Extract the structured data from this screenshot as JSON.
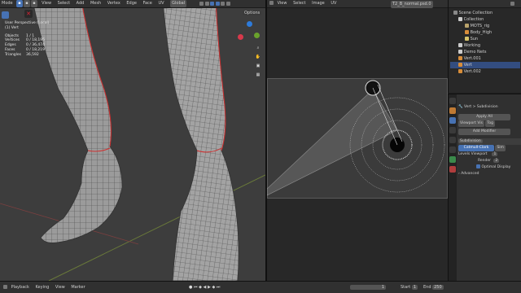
{
  "viewport3d": {
    "mode_label": "Mode",
    "menu": [
      "View",
      "Select",
      "Add",
      "Mesh",
      "Vertex",
      "Edge",
      "Face",
      "UV"
    ],
    "transform_orientation": "Global",
    "options_label": "Options",
    "overlay_text": {
      "view_name": "User Perspective (Local)",
      "object_name": "(1) Vert",
      "stats": [
        {
          "label": "Objects",
          "value": "1 / 1"
        },
        {
          "label": "Vertices",
          "value": "0 / 18,195"
        },
        {
          "label": "Edges",
          "value": "0 / 36,474"
        },
        {
          "label": "Faces",
          "value": "0 / 18,219"
        },
        {
          "label": "Triangles",
          "value": "36,592"
        }
      ]
    },
    "gizmo_axes": [
      "X",
      "Y",
      "Z"
    ]
  },
  "uv_editor": {
    "menu": [
      "View",
      "Select",
      "Image",
      "UV"
    ],
    "image_name": "T2_B_normal.psd.0"
  },
  "outliner": {
    "items": [
      {
        "label": "Scene Collection",
        "indent": 0
      },
      {
        "label": "Collection",
        "indent": 1
      },
      {
        "label": "MOTS_rig",
        "indent": 2
      },
      {
        "label": "Body_High",
        "indent": 2
      },
      {
        "label": "Sun",
        "indent": 2
      },
      {
        "label": "Working",
        "indent": 1
      },
      {
        "label": "Demo Nets",
        "indent": 1
      },
      {
        "label": "Vert.001",
        "indent": 1
      },
      {
        "label": "Vert",
        "indent": 1,
        "selected": true
      },
      {
        "label": "Vert.002",
        "indent": 1
      }
    ]
  },
  "properties": {
    "object_name": "Vert",
    "modifier_breadcrumb": "Subdivision",
    "apply_all": "Apply All",
    "viewport_vis": "Viewport Vis",
    "toggle_label": "Tog",
    "add_modifier": "Add Modifier",
    "modifier_name": "Subdivision",
    "algorithm_tabs": [
      "Catmull-Clark",
      "Sim"
    ],
    "levels_viewport_label": "Levels Viewport",
    "levels_viewport_value": "1",
    "render_label": "Render",
    "render_value": "2",
    "optimal_display": "Optimal Display",
    "advanced": "Advanced"
  },
  "timeline": {
    "menu": [
      "Playback",
      "Keying",
      "View",
      "Marker"
    ],
    "current_frame": "1",
    "start_label": "Start",
    "start_value": "1",
    "end_label": "End",
    "end_value": "250"
  }
}
